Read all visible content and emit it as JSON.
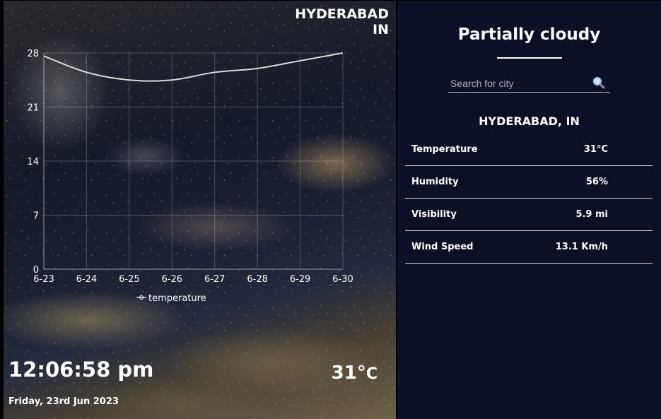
{
  "location": {
    "city": "HYDERABAD",
    "country": "IN",
    "full": "HYDERABAD, IN"
  },
  "clock": {
    "time": "12:06:58 pm",
    "date": "Friday, 23rd Jun 2023"
  },
  "current": {
    "temp": "31°",
    "unit": "C"
  },
  "condition": "Partially cloudy",
  "search": {
    "placeholder": "Search for city",
    "icon": "magnifier-icon"
  },
  "stats": [
    {
      "label": "Temperature",
      "value": "31°C"
    },
    {
      "label": "Humidity",
      "value": "56%"
    },
    {
      "label": "Visibility",
      "value": "5.9 mi"
    },
    {
      "label": "Wind Speed",
      "value": "13.1 Km/h"
    }
  ],
  "colors": {
    "panel": "#0b1027",
    "line": "#d9d9d9"
  },
  "chart_data": {
    "type": "line",
    "x": [
      "6-23",
      "6-24",
      "6-25",
      "6-26",
      "6-27",
      "6-28",
      "6-29",
      "6-30"
    ],
    "series": [
      {
        "name": "temperature",
        "values": [
          27.6,
          25.5,
          24.5,
          24.5,
          25.5,
          26.0,
          27.0,
          28.0
        ]
      }
    ],
    "yticks": [
      0,
      7,
      14,
      21,
      28
    ],
    "ylim": [
      0,
      28
    ],
    "grid": true,
    "legend": "bottom"
  }
}
